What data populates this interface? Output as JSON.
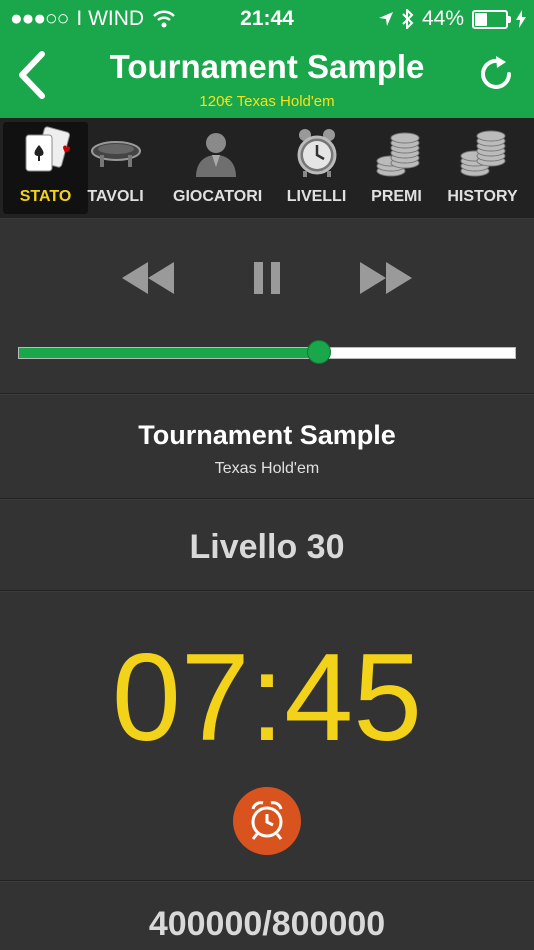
{
  "status_bar": {
    "signal_dots": "●●●○○",
    "carrier": "I WIND",
    "time": "21:44",
    "battery_percent": "44%",
    "battery_level": 0.44
  },
  "header": {
    "title": "Tournament Sample",
    "subtitle": "120€ Texas Hold'em"
  },
  "tabs": [
    {
      "label": "STATO",
      "icon": "cards-icon",
      "active": true
    },
    {
      "label": "TAVOLI",
      "icon": "poker-table-icon",
      "active": false
    },
    {
      "label": "GIOCATORI",
      "icon": "player-icon",
      "active": false
    },
    {
      "label": "LIVELLI",
      "icon": "alarm-clock-icon",
      "active": false
    },
    {
      "label": "PREMI",
      "icon": "chips-icon",
      "active": false
    },
    {
      "label": "HISTORY",
      "icon": "chips-stack-icon",
      "active": false
    }
  ],
  "progress": {
    "value": 0.605
  },
  "tournament": {
    "name": "Tournament Sample",
    "game": "Texas Hold'em"
  },
  "level": {
    "label": "Livello 30"
  },
  "timer": {
    "value": "07:45"
  },
  "blinds": {
    "value": "400000/800000"
  },
  "colors": {
    "brand_green": "#1aa64a",
    "accent_yellow": "#f3d21a",
    "background": "#333333",
    "alarm_orange": "#d9531e"
  }
}
